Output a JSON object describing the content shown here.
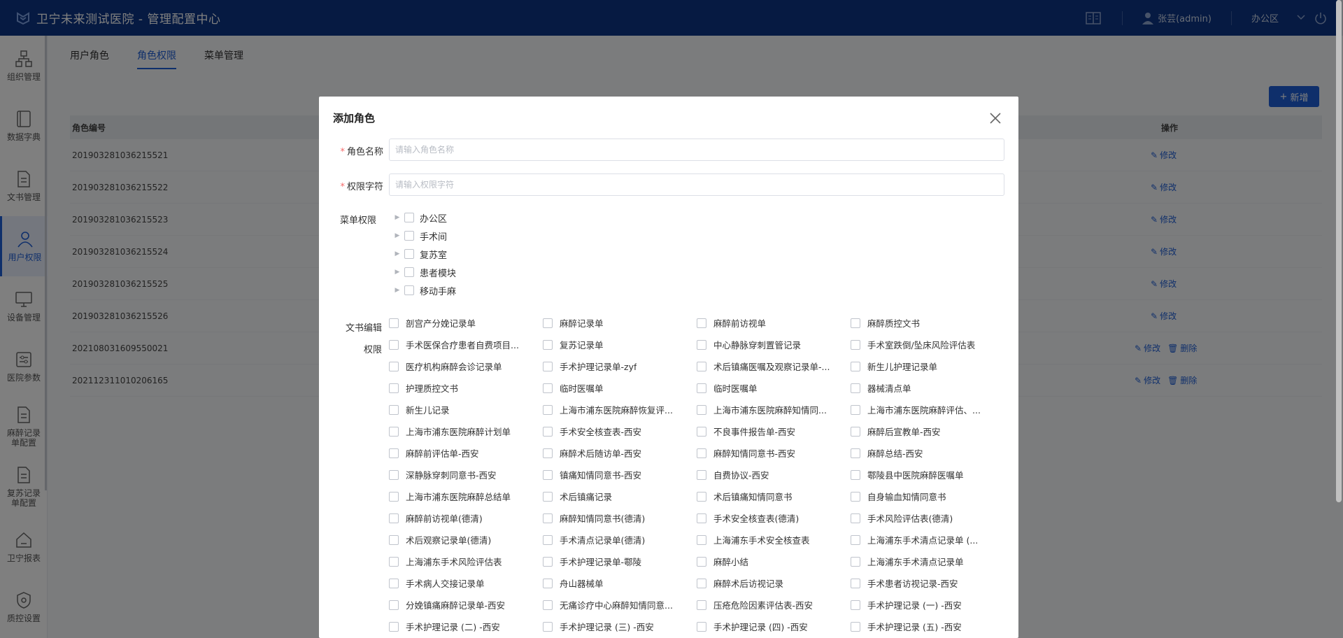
{
  "app": {
    "title": "卫宁未来测试医院 - 管理配置中心"
  },
  "header": {
    "user": "张芸(admin)",
    "area": "办公区"
  },
  "sidebar": {
    "items": [
      {
        "label": "组织管理"
      },
      {
        "label": "数据字典"
      },
      {
        "label": "文书管理"
      },
      {
        "label": "用户权限"
      },
      {
        "label": "设备管理"
      },
      {
        "label": "医院参数"
      },
      {
        "label": "麻醉记录\n单配置"
      },
      {
        "label": "复苏记录\n单配置"
      },
      {
        "label": "卫宁报表"
      },
      {
        "label": "质控设置"
      }
    ]
  },
  "tabs": [
    {
      "label": "用户角色"
    },
    {
      "label": "角色权限"
    },
    {
      "label": "菜单管理"
    }
  ],
  "toolbar": {
    "new_label": "新增"
  },
  "table": {
    "headers": {
      "code": "角色编号",
      "ops": "操作"
    },
    "rows": [
      {
        "code": "201903281036215521"
      },
      {
        "code": "201903281036215522"
      },
      {
        "code": "201903281036215523"
      },
      {
        "code": "201903281036215524"
      },
      {
        "code": "201903281036215525"
      },
      {
        "code": "201903281036215526"
      },
      {
        "code": "202108031609550021"
      },
      {
        "code": "202112311010206165"
      }
    ],
    "edit_label": "修改",
    "delete_label": "删除"
  },
  "dialog": {
    "title": "添加角色",
    "role_name": {
      "label": "角色名称",
      "placeholder": "请输入角色名称",
      "value": ""
    },
    "permission_key": {
      "label": "权限字符",
      "placeholder": "请输入权限字符",
      "value": ""
    },
    "menu_label": "菜单权限",
    "menu_tree": [
      {
        "label": "办公区"
      },
      {
        "label": "手术间"
      },
      {
        "label": "复苏室"
      },
      {
        "label": "患者模块"
      },
      {
        "label": "移动手麻"
      }
    ],
    "doc_label_1": "文书编辑",
    "doc_label_2": "权限",
    "documents": [
      "剖宫产分娩记录单",
      "麻醉记录单",
      "麻醉前访视单",
      "麻醉质控文书",
      "手术医保合疗患者自费项目...",
      "复苏记录单",
      "中心静脉穿刺置管记录",
      "手术室跌倒/坠床风险评估表",
      "医疗机构麻醉会诊记录单",
      "手术护理记录单-zyf",
      "术后镇痛医嘱及观察记录单-...",
      "新生儿护理记录单",
      "护理质控文书",
      "临时医嘱单",
      "临时医嘱单",
      "器械清点单",
      "新生儿记录",
      "上海市浦东医院麻醉恢复评...",
      "上海市浦东医院麻醉知情同...",
      "上海市浦东医院麻醉评估、...",
      "上海市浦东医院麻醉计划单",
      "手术安全核查表-西安",
      "不良事件报告单-西安",
      "麻醉后宣教单-西安",
      "麻醉前评估单-西安",
      "麻醉术后随访单-西安",
      "麻醉知情同意书-西安",
      "麻醉总结-西安",
      "深静脉穿刺同意书-西安",
      "镇痛知情同意书-西安",
      "自费协议-西安",
      "鄠陵县中医院麻醉医嘱单",
      "上海市浦东医院麻醉总结单",
      "术后镇痛记录",
      "术后镇痛知情同意书",
      "自身输血知情同意书",
      "麻醉前访视单(德清)",
      "麻醉知情同意书(德清)",
      "手术安全核查表(德清)",
      "手术风险评估表(德清)",
      "术后观察记录单(德清)",
      "手术清点记录单(德清)",
      "上海浦东手术安全核查表",
      "上海浦东手术清点记录单 (...",
      "上海浦东手术风险评估表",
      "手术护理记录单-鄠陵",
      "麻醉小结",
      "上海浦东手术清点记录单",
      "手术病人交接记录单",
      "舟山器械单",
      "麻醉术后访视记录",
      "手术患者访视记录-西安",
      "分娩镇痛麻醉记录单-西安",
      "无痛诊疗中心麻醉知情同意...",
      "压疮危险因素评估表-西安",
      "手术护理记录 (一) -西安",
      "手术护理记录 (二) -西安",
      "手术护理记录 (三) -西安",
      "手术护理记录 (四) -西安",
      "手术护理记录 (五) -西安"
    ]
  },
  "colors": {
    "primary": "#1f5fd6",
    "topbar": "#0c3584",
    "required": "#f56c6c"
  }
}
